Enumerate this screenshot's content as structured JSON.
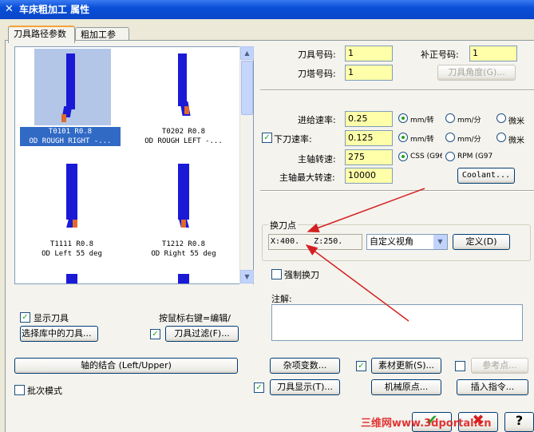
{
  "window": {
    "title": "车床粗加工 属性"
  },
  "tabs": [
    {
      "label": "刀具路径参数"
    },
    {
      "label": "粗加工参数"
    }
  ],
  "tools": [
    {
      "caption1": "T0101 R0.8",
      "caption2": "OD ROUGH RIGHT -..."
    },
    {
      "caption1": "T0202 R0.8",
      "caption2": "OD ROUGH LEFT -..."
    },
    {
      "caption1": "T1111 R0.8",
      "caption2": "OD Left 55 deg"
    },
    {
      "caption1": "T1212 R0.8",
      "caption2": "OD Right 55 deg"
    }
  ],
  "left": {
    "show_tools_label": "显示刀具",
    "right_click_hint": "按鼠标右键=编辑/",
    "select_from_lib": "选择库中的刀具...",
    "filter_button": "刀具过滤(F)...",
    "axis_combo_button": "轴的结合 (Left/Upper)",
    "batch_mode_label": "批次模式"
  },
  "params": {
    "tool_no_label": "刀具号码:",
    "tool_no_value": "1",
    "offset_no_label": "补正号码:",
    "offset_no_value": "1",
    "turret_no_label": "刀塔号码:",
    "turret_no_value": "1",
    "tool_angle_button": "刀具角度(G)...",
    "feed_rate_label": "进给速率:",
    "feed_rate_value": "0.25",
    "plunge_rate_label": "下刀速率:",
    "plunge_rate_value": "0.125",
    "spindle_label": "主轴转速:",
    "spindle_value": "275",
    "max_spindle_label": "主轴最大转速:",
    "max_spindle_value": "10000",
    "mm_per_rev": "mm/转",
    "mm_per_min": "mm/分",
    "micron": "微米",
    "css": "CSS (G96",
    "rpm": "RPM (G97",
    "coolant_button": "Coolant..."
  },
  "tool_change": {
    "group_label": "换刀点",
    "coords": "X:400.   Z:250.",
    "view_value": "自定义视角",
    "define_button": "定义(D)",
    "force_change_label": "强制换刀"
  },
  "notes": {
    "label": "注解:"
  },
  "bottom": {
    "misc_vars": "杂项变数...",
    "stock_update": "素材更新(S)...",
    "ref_point": "参考点...",
    "tool_display": "刀具显示(T)...",
    "machine_origin": "机械原点...",
    "insert_cmd": "插入指令..."
  },
  "watermark": "三维网www.3dportal.cn"
}
